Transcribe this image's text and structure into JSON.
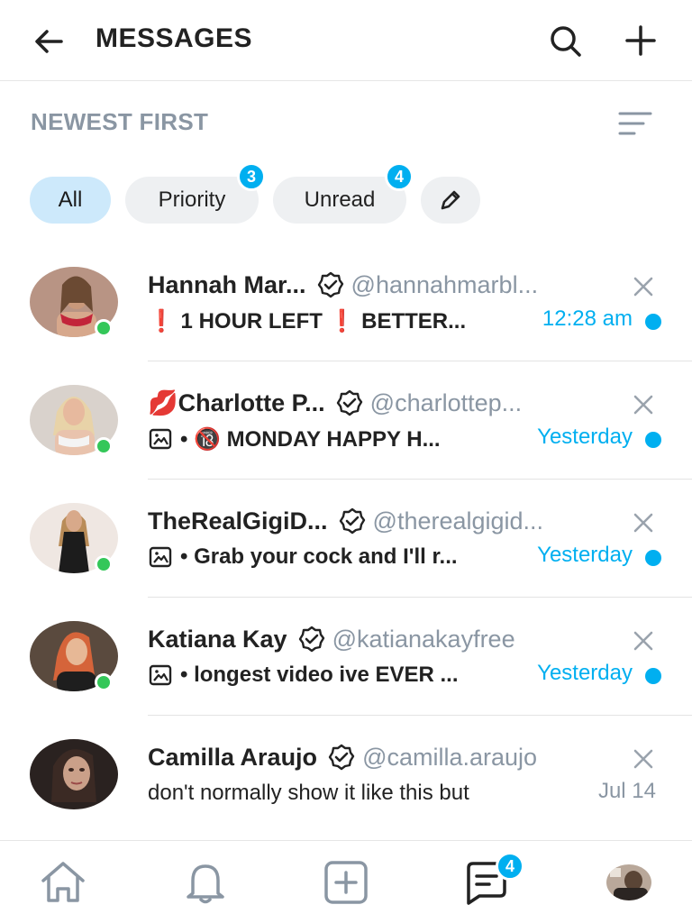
{
  "header": {
    "title": "MESSAGES",
    "back_icon": "arrow-left-icon",
    "search_icon": "search-icon",
    "add_icon": "plus-icon"
  },
  "sort": {
    "label": "NEWEST FIRST",
    "icon": "sort-lines-icon"
  },
  "filters": [
    {
      "label": "All",
      "active": true,
      "badge": ""
    },
    {
      "label": "Priority",
      "active": false,
      "badge": "3"
    },
    {
      "label": "Unread",
      "active": false,
      "badge": "4"
    }
  ],
  "edit_chip_icon": "pencil-icon",
  "conversations": [
    {
      "name": "Hannah Mar...",
      "handle": "@hannahmarbl...",
      "verified": true,
      "online": true,
      "message": "❗ 1 HOUR LEFT ❗ BETTER...",
      "has_media": false,
      "time": "12:28 am",
      "unread": true
    },
    {
      "name": "💋Charlotte P...",
      "handle": "@charlottep...",
      "verified": true,
      "online": true,
      "message": "• 🔞 MONDAY HAPPY H...",
      "has_media": true,
      "time": "Yesterday",
      "unread": true
    },
    {
      "name": "TheRealGigiD...",
      "handle": "@therealgigid...",
      "verified": true,
      "online": true,
      "message": "• Grab your cock and I'll r...",
      "has_media": true,
      "time": "Yesterday",
      "unread": true
    },
    {
      "name": "Katiana Kay",
      "handle": "@katianakayfree",
      "verified": true,
      "online": true,
      "message": "• longest video ive EVER ...",
      "has_media": true,
      "time": "Yesterday",
      "unread": true
    },
    {
      "name": "Camilla Araujo",
      "handle": "@camilla.araujo",
      "verified": true,
      "online": false,
      "message": "don't normally show it like this but",
      "has_media": false,
      "time": "Jul 14",
      "unread": false
    }
  ],
  "tabbar": {
    "items": [
      "home-icon",
      "bell-icon",
      "add-post-icon",
      "messages-icon",
      "profile-avatar"
    ],
    "messages_badge": "4"
  },
  "colors": {
    "accent": "#00aff0",
    "muted": "#8a96a3",
    "online": "#34c759",
    "active_chip": "#cde9fb"
  }
}
